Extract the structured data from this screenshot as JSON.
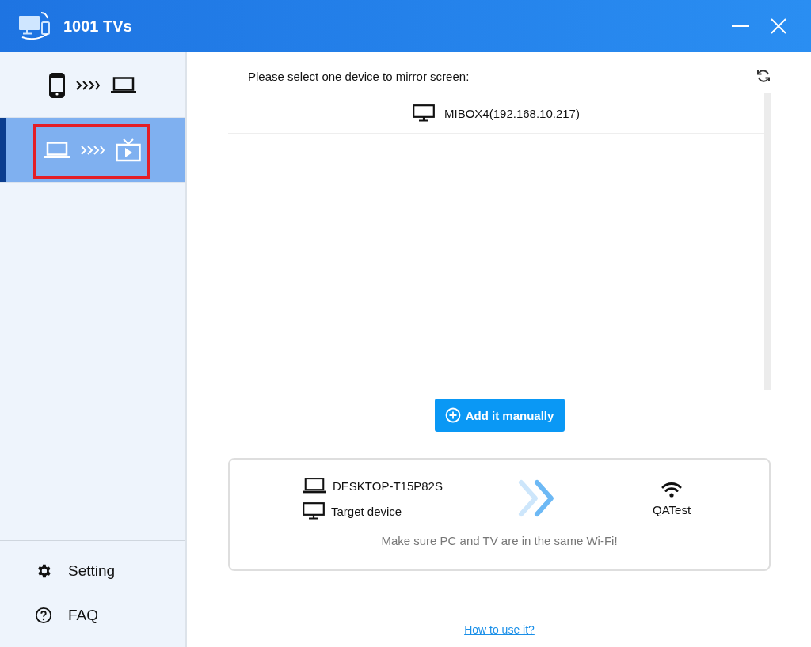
{
  "window": {
    "title": "1001 TVs"
  },
  "sidebar": {
    "modes": [
      {
        "kind": "phone-to-pc",
        "selected": false,
        "highlighted": false
      },
      {
        "kind": "pc-to-tv",
        "selected": true,
        "highlighted": true
      }
    ],
    "menu": [
      {
        "kind": "settings",
        "label": "Setting"
      },
      {
        "kind": "help",
        "label": "FAQ"
      }
    ]
  },
  "main": {
    "prompt": "Please select one device to mirror screen:",
    "devices": [
      {
        "name": "MIBOX4(192.168.10.217)"
      }
    ],
    "add_button": "Add it manually",
    "info": {
      "source": "DESKTOP-T15P82S",
      "target": "Target device",
      "network": "QATest",
      "note": "Make sure PC and TV are in the same Wi-Fi!"
    },
    "help_link": "How to use it?"
  }
}
